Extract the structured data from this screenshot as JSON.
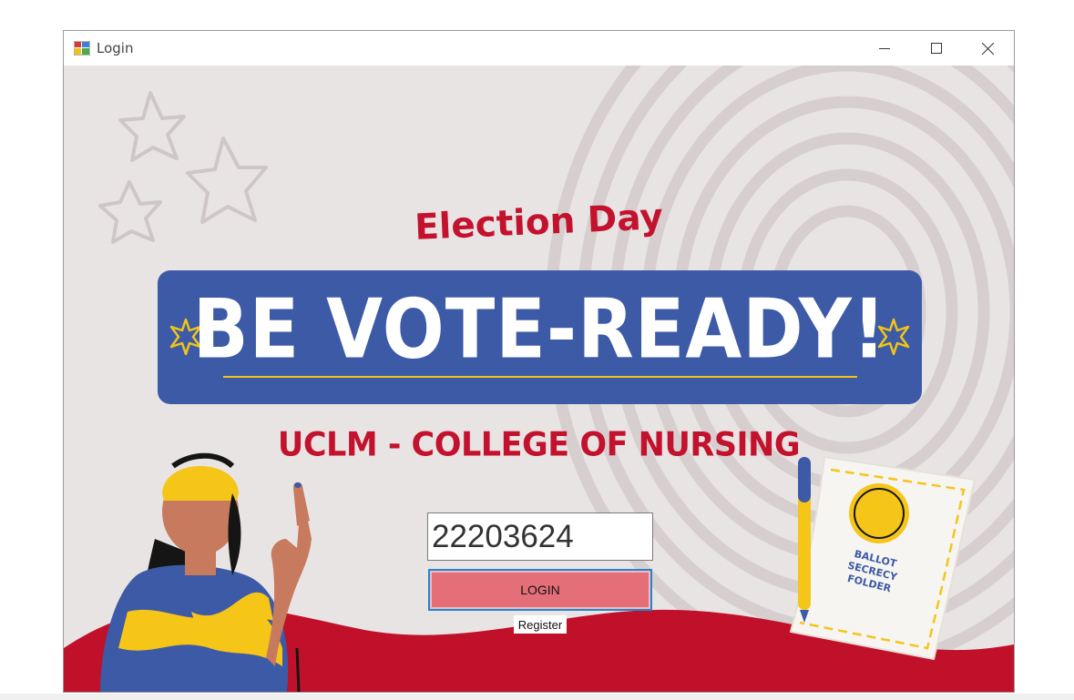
{
  "window": {
    "title": "Login",
    "icon": "windows-form-icon",
    "controls": [
      "minimize-icon",
      "maximize-icon",
      "close-icon"
    ]
  },
  "poster": {
    "heading": "Election Day",
    "banner": "BE VOTE-READY!",
    "subtitle": "UCLM - COLLEGE OF NURSING",
    "folder_label_line1": "BALLOT SECRECY",
    "folder_label_line2": "FOLDER"
  },
  "form": {
    "id_value": "22203624",
    "login_label": "LOGIN",
    "register_label": "Register"
  },
  "colors": {
    "background": "#e9e4e4",
    "banner_blue": "#3d5aa6",
    "accent_red": "#c3122d",
    "wave_red": "#c0102a",
    "login_button": "#e56f79",
    "star_yellow": "#f0c419"
  }
}
